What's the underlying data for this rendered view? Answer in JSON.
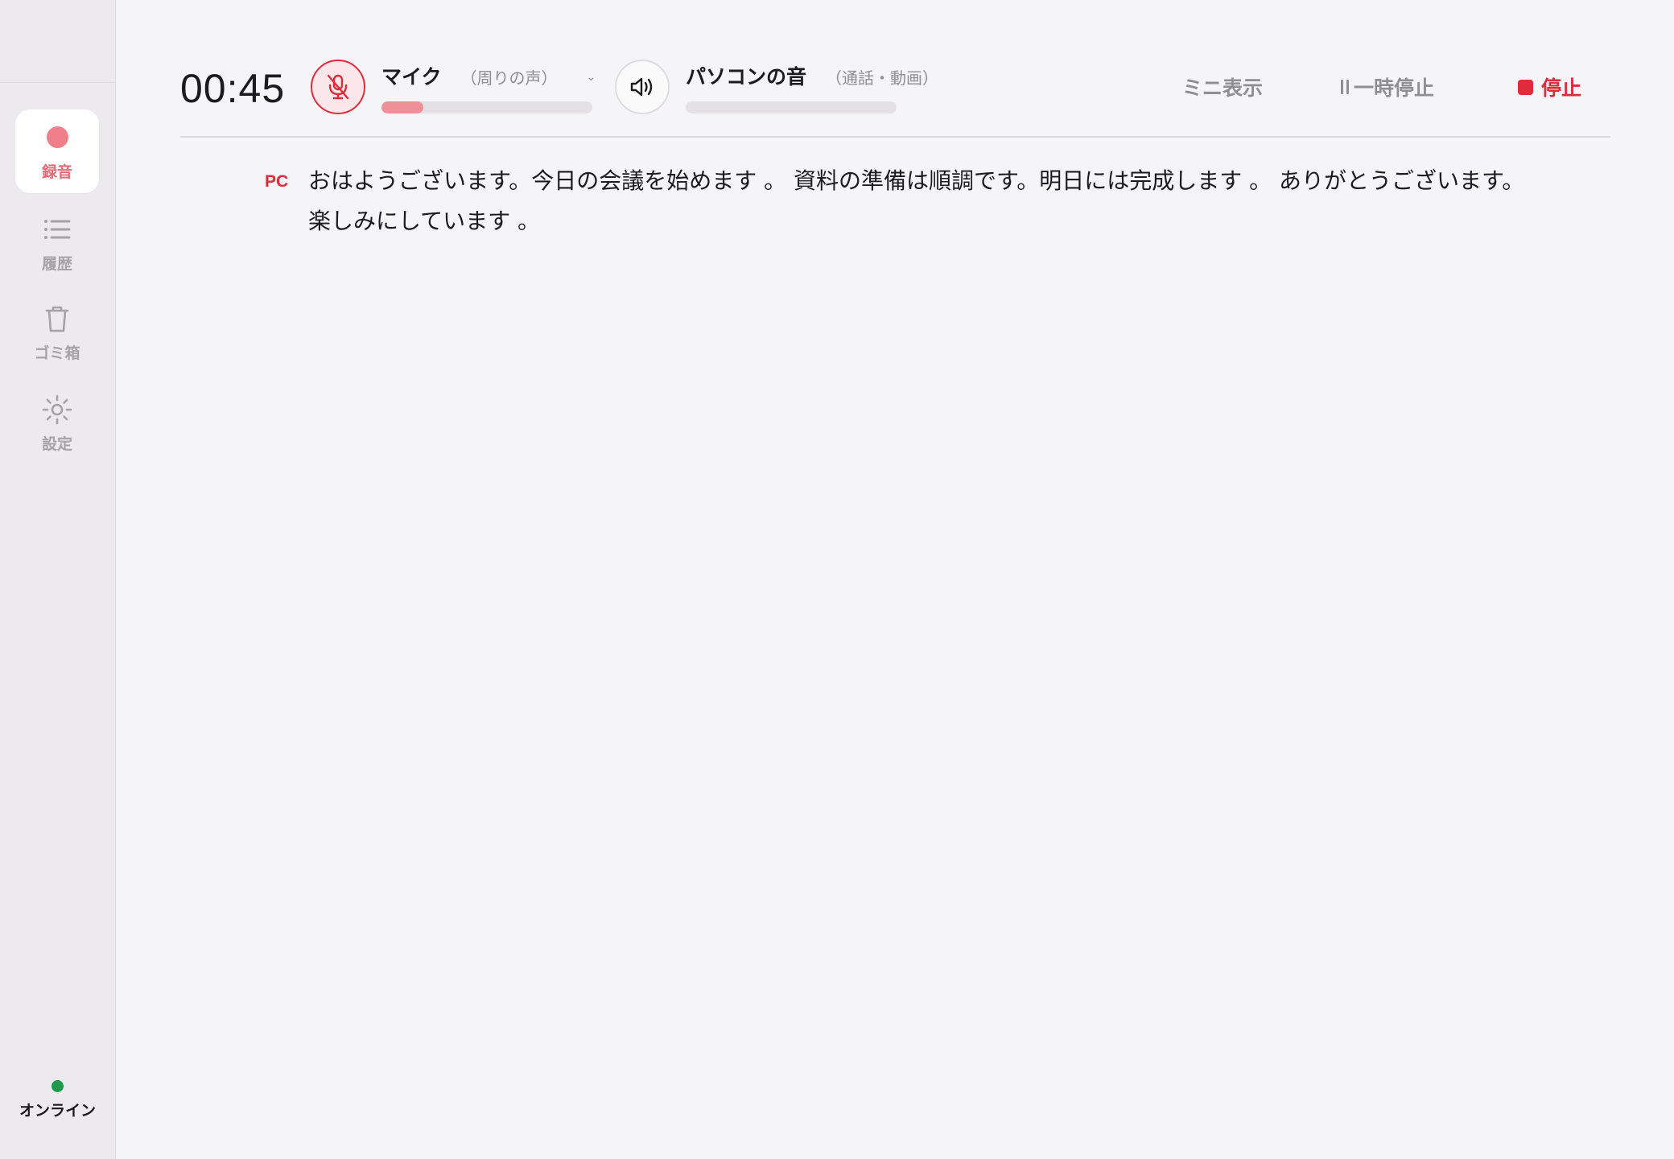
{
  "sidebar": {
    "items": [
      {
        "id": "record",
        "label": "録音",
        "icon": "record-icon",
        "active": true
      },
      {
        "id": "history",
        "label": "履歴",
        "icon": "list-icon",
        "active": false
      },
      {
        "id": "trash",
        "label": "ゴミ箱",
        "icon": "trash-icon",
        "active": false
      },
      {
        "id": "settings",
        "label": "設定",
        "icon": "gear-icon",
        "active": false
      }
    ],
    "status": {
      "label": "オンライン",
      "color": "#1f9a4b"
    }
  },
  "toolbar": {
    "timer": "00:45",
    "mic": {
      "name": "マイク",
      "sub": "（周りの声）",
      "level": 0.2,
      "muted": true
    },
    "pc_audio": {
      "name": "パソコンの音",
      "sub": "（通話・動画）",
      "level": 0.0
    },
    "mini_label": "ミニ表示",
    "pause_label": "一時停止",
    "stop_label": "停止"
  },
  "transcript": {
    "entries": [
      {
        "speaker": "PC",
        "text": "おはようございます。今日の会議を始めます 。 資料の準備は順調です。明日には完成します 。 ありがとうございます。楽しみにしています 。"
      }
    ]
  },
  "colors": {
    "accent": "#e22b3a",
    "accent_soft": "#ef7f89",
    "online": "#1f9a4b"
  }
}
